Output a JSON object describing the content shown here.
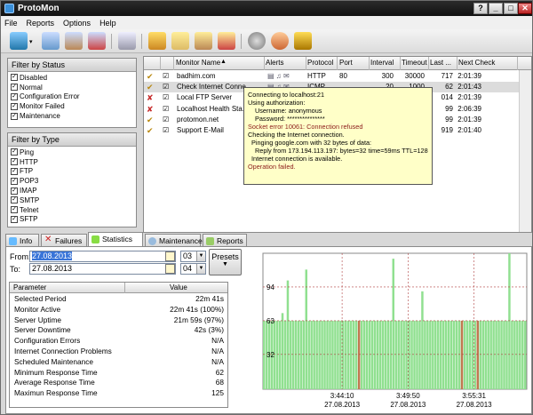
{
  "window": {
    "title": "ProtoMon",
    "help_btn": "?",
    "min_btn": "_",
    "max_btn": "□",
    "close_btn": "✕"
  },
  "menu": [
    "File",
    "Reports",
    "Options",
    "Help"
  ],
  "toolbar_icons": [
    "monitor-add-icon",
    "monitor-clone-icon",
    "monitor-edit-icon",
    "monitor-delete-icon",
    "note-icon",
    "group-add-icon",
    "folder-icon",
    "group-edit-icon",
    "group-delete-icon",
    "settings-icon",
    "user-icon",
    "help-book-icon"
  ],
  "status_filter": {
    "title": "Filter by Status",
    "items": [
      "Disabled",
      "Normal",
      "Configuration Error",
      "Monitor Failed",
      "Maintenance"
    ]
  },
  "type_filter": {
    "title": "Filter by Type",
    "items": [
      "Ping",
      "HTTP",
      "FTP",
      "POP3",
      "IMAP",
      "SMTP",
      "Telnet",
      "SFTP"
    ]
  },
  "grid": {
    "headers": {
      "name": "Monitor Name",
      "alerts": "Alerts",
      "protocol": "Protocol",
      "port": "Port",
      "interval": "Interval",
      "timeout": "Timeout",
      "last": "Last ...",
      "next": "Next Check"
    },
    "rows": [
      {
        "status": "ok",
        "name": "badhim.com",
        "protocol": "HTTP",
        "port": "80",
        "interval": "300",
        "timeout": "30000",
        "last": "717",
        "next": "2:01:39"
      },
      {
        "status": "ok",
        "name": "Check Internet Conne...",
        "protocol": "ICMP",
        "port": "",
        "interval": "20",
        "timeout": "1000",
        "last": "62",
        "next": "2:01:43"
      },
      {
        "status": "fail",
        "name": "Local FTP Server",
        "protocol": "",
        "port": "",
        "interval": "",
        "timeout": "",
        "last": "014",
        "next": "2:01:39"
      },
      {
        "status": "fail",
        "name": "Localhost Health Sta...",
        "protocol": "",
        "port": "",
        "interval": "",
        "timeout": "",
        "last": "99",
        "next": "2:06:39"
      },
      {
        "status": "ok",
        "name": "protomon.net",
        "protocol": "",
        "port": "",
        "interval": "",
        "timeout": "",
        "last": "99",
        "next": "2:01:39"
      },
      {
        "status": "ok",
        "name": "Support E-Mail",
        "protocol": "",
        "port": "",
        "interval": "",
        "timeout": "",
        "last": "919",
        "next": "2:01:40"
      }
    ]
  },
  "tooltip": [
    {
      "text": "Connecting to localhost:21",
      "color": "#000",
      "indent": 0
    },
    {
      "text": "Using authorization:",
      "color": "#000",
      "indent": 0
    },
    {
      "text": "Username: anonymous",
      "color": "#000",
      "indent": 8
    },
    {
      "text": "Password: ***************",
      "color": "#000",
      "indent": 8
    },
    {
      "text": "Socket error 10061: Connection refused",
      "color": "#8b1a1a",
      "indent": 0
    },
    {
      "text": "Checking the Internet connection.",
      "color": "#000",
      "indent": 0
    },
    {
      "text": "Pinging google.com with 32 bytes of data:",
      "color": "#000",
      "indent": 4
    },
    {
      "text": "Reply from 173.194.113.197: bytes=32 time=59ms TTL=128",
      "color": "#000",
      "indent": 8
    },
    {
      "text": "Internet connection is available.",
      "color": "#000",
      "indent": 4
    },
    {
      "text": "Operation failed.",
      "color": "#8b1a1a",
      "indent": 0
    }
  ],
  "tabs": [
    "Info",
    "Failures",
    "Statistics",
    "Maintenance",
    "Reports"
  ],
  "stats": {
    "from_label": "From:",
    "from_date": "27.08.2013",
    "from_hour": "03",
    "to_label": "To:",
    "to_date": "27.08.2013",
    "to_hour": "04",
    "presets": "Presets",
    "param_header": "Parameter",
    "value_header": "Value",
    "rows": [
      [
        "Selected Period",
        "22m 41s"
      ],
      [
        "Monitor Active",
        "22m 41s (100%)"
      ],
      [
        "Server Uptime",
        "21m 59s (97%)"
      ],
      [
        "Server Downtime",
        "42s (3%)"
      ],
      [
        "Configuration Errors",
        "N/A"
      ],
      [
        "Internet Connection Problems",
        "N/A"
      ],
      [
        "Scheduled Maintenance",
        "N/A"
      ],
      [
        "Minimum Response Time",
        "62"
      ],
      [
        "Average Response Time",
        "68"
      ],
      [
        "Maximun Response Time",
        "125"
      ]
    ]
  },
  "chart_data": {
    "type": "bar",
    "yticks": [
      "94",
      "63",
      "32"
    ],
    "ylim": [
      0,
      125
    ],
    "xticks": [
      {
        "time": "3:44:10",
        "date": "27.08.2013"
      },
      {
        "time": "3:49:50",
        "date": "27.08.2013"
      },
      {
        "time": "3:55:31",
        "date": "27.08.2013"
      }
    ],
    "values": [
      63,
      63,
      63,
      63,
      63,
      63,
      63,
      70,
      63,
      100,
      63,
      63,
      63,
      63,
      63,
      63,
      110,
      63,
      63,
      63,
      63,
      63,
      63,
      63,
      63,
      63,
      63,
      63,
      63,
      63,
      63,
      63,
      63,
      63,
      63,
      63,
      63,
      63,
      63,
      63,
      63,
      63,
      63,
      63,
      63,
      63,
      63,
      63,
      63,
      120,
      63,
      63,
      63,
      63,
      63,
      63,
      63,
      63,
      63,
      63,
      90,
      63,
      63,
      63,
      63,
      63,
      63,
      63,
      63,
      63,
      63,
      63,
      63,
      63,
      63,
      63,
      63,
      63,
      63,
      63,
      63,
      63,
      63,
      63,
      63,
      63,
      63,
      63,
      63,
      63,
      63,
      63,
      63,
      125,
      63,
      63,
      63,
      63,
      63,
      63
    ],
    "failed_indices": [
      36,
      75,
      81
    ],
    "colors": {
      "ok": "#90e090",
      "fail": "#c07850",
      "grid": "#b04040"
    }
  }
}
